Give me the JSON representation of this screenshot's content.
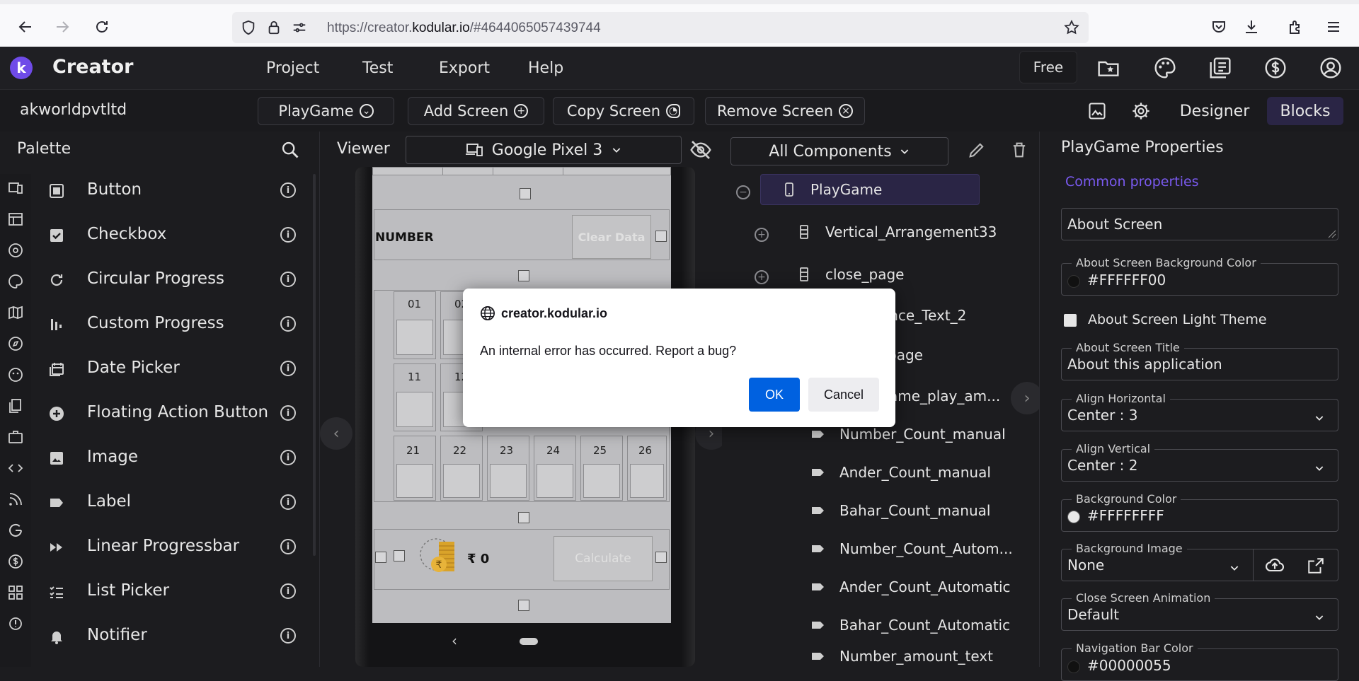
{
  "browser": {
    "url_prefix": "https://creator.",
    "url_host": "kodular.io",
    "url_suffix": "/#4644065057439744"
  },
  "header": {
    "logo_letter": "k",
    "brand": "Creator",
    "menus": [
      "Project",
      "Test",
      "Export",
      "Help"
    ],
    "free_label": "Free"
  },
  "toolbar": {
    "project_name": "akworldpvtltd",
    "screen_select": "PlayGame",
    "add_screen": "Add Screen",
    "copy_screen": "Copy Screen",
    "remove_screen": "Remove Screen",
    "designer": "Designer",
    "blocks": "Blocks"
  },
  "palette": {
    "title": "Palette",
    "items": [
      {
        "label": "Button",
        "icon": "button-icon"
      },
      {
        "label": "Checkbox",
        "icon": "checkbox-icon"
      },
      {
        "label": "Circular Progress",
        "icon": "circular-progress-icon"
      },
      {
        "label": "Custom Progress",
        "icon": "custom-progress-icon"
      },
      {
        "label": "Date Picker",
        "icon": "calendar-icon"
      },
      {
        "label": "Floating Action Button",
        "icon": "plus-circle-icon"
      },
      {
        "label": "Image",
        "icon": "image-icon"
      },
      {
        "label": "Label",
        "icon": "label-icon"
      },
      {
        "label": "Linear Progressbar",
        "icon": "fast-forward-icon"
      },
      {
        "label": "List Picker",
        "icon": "list-icon"
      },
      {
        "label": "Notifier",
        "icon": "bell-icon"
      }
    ]
  },
  "viewer": {
    "title": "Viewer",
    "device": "Google Pixel 3",
    "number_label": "NUMBER",
    "clear_data": "Clear Data",
    "grid_row1": [
      "01",
      "02"
    ],
    "grid_row2": [
      "11",
      "12"
    ],
    "grid_row3": [
      "21",
      "22",
      "23",
      "24",
      "25",
      "26"
    ],
    "rupee_text": "₹  0",
    "calculate": "Calculate"
  },
  "components": {
    "filter": "All Components",
    "items": [
      {
        "label": "PlayGame"
      },
      {
        "label": "Vertical_Arrangement33"
      },
      {
        "label": "close_page"
      },
      {
        "label": "ance_Text_2"
      },
      {
        "label": "_page"
      },
      {
        "label": "ame_play_am..."
      },
      {
        "label": "Number_Count_manual"
      },
      {
        "label": "Ander_Count_manual"
      },
      {
        "label": "Bahar_Count_manual"
      },
      {
        "label": "Number_Count_Autom..."
      },
      {
        "label": "Ander_Count_Automatic"
      },
      {
        "label": "Bahar_Count_Automatic"
      },
      {
        "label": "Number_amount_text"
      }
    ]
  },
  "properties": {
    "title": "PlayGame Properties",
    "common": "Common properties",
    "about_screen_value": "About Screen",
    "bg_color_label": "About Screen Background Color",
    "bg_color_value": "#FFFFFF00",
    "light_theme_label": "About Screen Light Theme",
    "title_label": "About Screen Title",
    "title_value": "About this application",
    "align_h_label": "Align Horizontal",
    "align_h_value": "Center : 3",
    "align_v_label": "Align Vertical",
    "align_v_value": "Center : 2",
    "background_color_label": "Background Color",
    "background_color_value": "#FFFFFFFF",
    "background_image_label": "Background Image",
    "background_image_value": "None",
    "close_anim_label": "Close Screen Animation",
    "close_anim_value": "Default",
    "nav_bar_label": "Navigation Bar Color",
    "nav_bar_value": "#00000055"
  },
  "modal": {
    "host": "creator.kodular.io",
    "message": "An internal error has occurred. Report a bug?",
    "ok": "OK",
    "cancel": "Cancel"
  }
}
